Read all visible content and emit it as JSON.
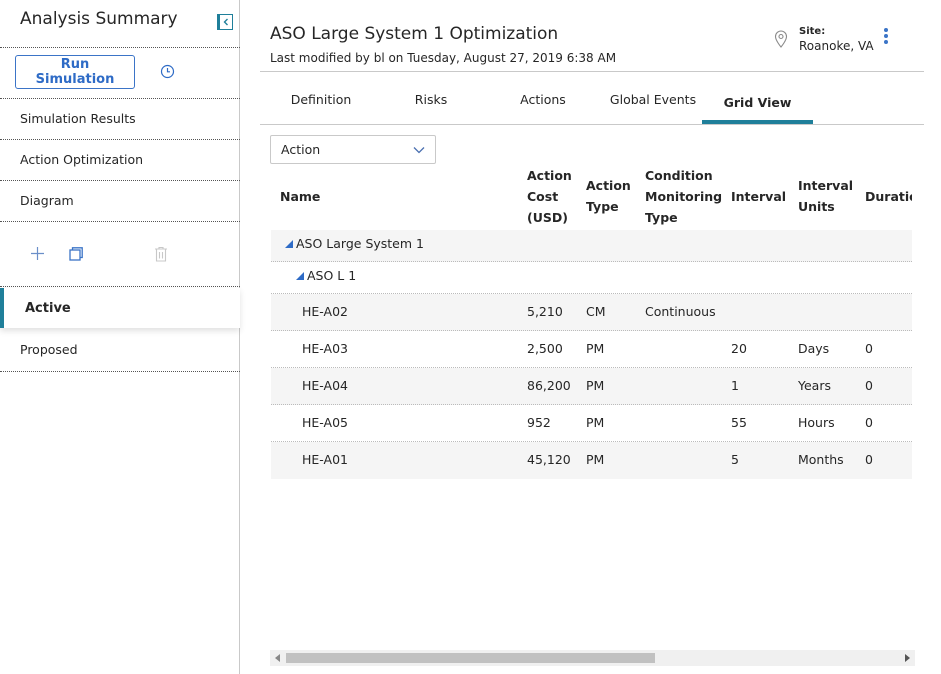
{
  "sidebar": {
    "title": "Analysis Summary",
    "run_button": "Run Simulation",
    "items": [
      "Simulation Results",
      "Action Optimization",
      "Diagram"
    ],
    "scenarios": [
      "Active",
      "Proposed"
    ],
    "icons": [
      "collapse-panel-icon",
      "history-clock-icon",
      "add-icon",
      "copy-icon",
      "trash-icon"
    ]
  },
  "header": {
    "title": "ASO Large System 1 Optimization",
    "modified": "Last modified by bl on Tuesday, August 27, 2019 6:38 AM",
    "site_label": "Site:",
    "site_value": "Roanoke, VA"
  },
  "tabs": [
    "Definition",
    "Risks",
    "Actions",
    "Global Events",
    "Grid View"
  ],
  "active_tab": "Grid View",
  "filter": {
    "selected": "Action"
  },
  "grid": {
    "columns": {
      "name": [
        "Name"
      ],
      "cost": [
        "Action",
        "Cost",
        "(USD)"
      ],
      "type": [
        "Action",
        "Type"
      ],
      "cm": [
        "Condition",
        "Monitoring",
        "Type"
      ],
      "interval": [
        "Interval"
      ],
      "units": [
        "Interval",
        "Units"
      ],
      "duration": [
        "Duration"
      ]
    },
    "group1": "ASO Large System 1",
    "group2": "ASO L 1",
    "rows": [
      {
        "name": "HE-A02",
        "cost": "5,210",
        "type": "CM",
        "cm": "Continuous",
        "interval": "",
        "units": "",
        "duration": ""
      },
      {
        "name": "HE-A03",
        "cost": "2,500",
        "type": "PM",
        "cm": "",
        "interval": "20",
        "units": "Days",
        "duration": "0"
      },
      {
        "name": "HE-A04",
        "cost": "86,200",
        "type": "PM",
        "cm": "",
        "interval": "1",
        "units": "Years",
        "duration": "0"
      },
      {
        "name": "HE-A05",
        "cost": "952",
        "type": "PM",
        "cm": "",
        "interval": "55",
        "units": "Hours",
        "duration": "0"
      },
      {
        "name": "HE-A01",
        "cost": "45,120",
        "type": "PM",
        "cm": "",
        "interval": "5",
        "units": "Months",
        "duration": "0"
      }
    ]
  },
  "colors": {
    "accent": "#1f7f9a",
    "link_blue": "#2e6bc6"
  }
}
